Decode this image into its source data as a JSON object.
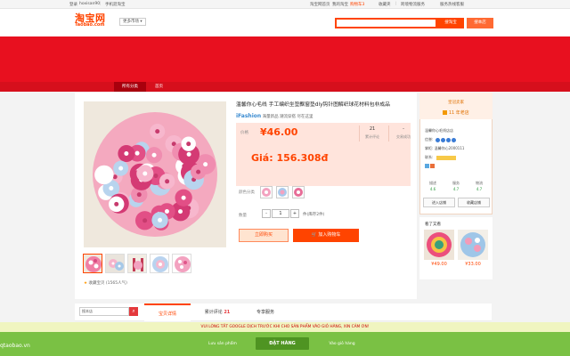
{
  "topbar": {
    "left": [
      "登录",
      "hoxisan90",
      "|",
      "手机逛淘宝"
    ],
    "right": [
      "淘宝网首页",
      "我的淘宝",
      "购物车3",
      "收藏夹",
      "|",
      "跨境物流服务",
      "服务热线客服"
    ]
  },
  "header": {
    "logo_cn": "淘宝网",
    "logo_en": "Taobao.com",
    "market_label": "更多市场",
    "search_button": "搜淘宝",
    "search_shop_button": "搜本店"
  },
  "nav": {
    "category_label": "所有分类",
    "home_label": "首页"
  },
  "product": {
    "title": "温馨你心毛线 手工编织坐垫飘窗垫diy钩针图解织球花材料包非成品",
    "brand": "iFashion",
    "brand_suffix": "海量新品 潮流穿搭 尽在这里",
    "price_label": "价格",
    "price": "¥46.00",
    "reviews_count": "21",
    "reviews_label": "累计评论",
    "trades_count": "-",
    "trades_label": "交易成功",
    "converted_price": "Giá: 156.308đ",
    "color_label": "颜色分类",
    "qty_label": "数量",
    "qty_minus": "-",
    "qty_value": "1",
    "qty_plus": "+",
    "stock": "件(库存2件)",
    "buy_now": "立即购买",
    "add_to_cart": "加入购物车",
    "favorites": "收藏宝贝 (1565人气)"
  },
  "shop": {
    "badge": "皇冠卖家",
    "years": "11 年老店",
    "name_row": "温馨你心毛线店店",
    "credit_row": "信誉:",
    "master_row": "掌柜: 温馨你心2000111",
    "contact_row": "联系:",
    "dsr": [
      {
        "label": "描述",
        "value": "4.6"
      },
      {
        "label": "服务",
        "value": "4.7"
      },
      {
        "label": "物流",
        "value": "4.7"
      }
    ],
    "enter_shop": "进入店铺",
    "favorite_shop": "收藏店铺"
  },
  "recommend": {
    "title": "看了又看",
    "items": [
      {
        "price": "¥49.00"
      },
      {
        "price": "¥33.00"
      }
    ]
  },
  "tabs": {
    "side_search_placeholder": "搜本店",
    "side_search_icon": "search-icon",
    "details": "宝贝详情",
    "reviews": "累计评论",
    "reviews_count": "21",
    "services": "专享服务"
  },
  "extension": {
    "notice": "VUI LÒNG TẮT GOOGLE DỊCH TRƯỚC KHI CHO SẢN PHẨM VÀO GIỎ HÀNG, XIN CẢM ƠN!",
    "site": "qtaobao.vn",
    "save_product": "Lưu sản phẩm",
    "order": "ĐẶT HÀNG",
    "add_to_cart": "Vào giỏ hàng"
  },
  "colors": {
    "brand_orange": "#ff4400",
    "banner_red": "#e8101f",
    "extension_green": "#7ac144"
  }
}
